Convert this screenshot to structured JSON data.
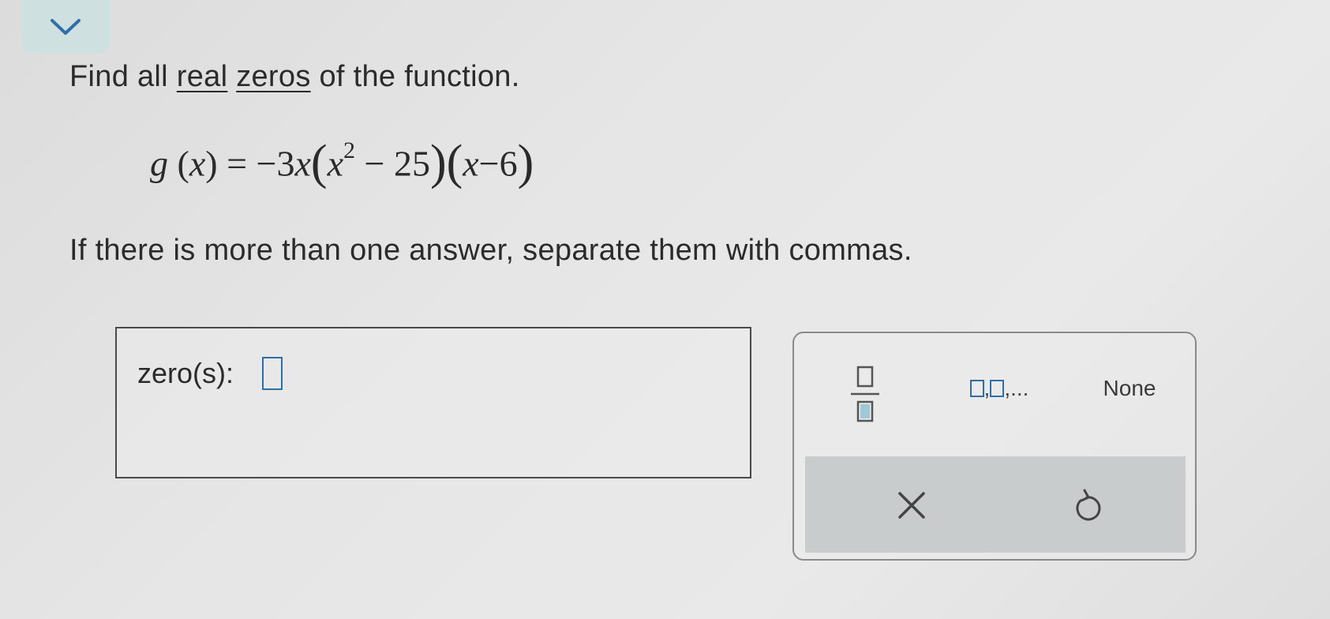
{
  "question": {
    "prefix": "Find all",
    "link_real": "real",
    "link_zeros": "zeros",
    "suffix": "of the function."
  },
  "equation": {
    "func": "g",
    "var": "x",
    "equals": "=",
    "coefficient": "−3",
    "term1_minus": "−",
    "exponent": "2",
    "const1": "25",
    "term2_minus": "−",
    "const2": "6"
  },
  "instruction": "If there is more than one answer, separate them with commas.",
  "answer": {
    "label": "zero(s):",
    "value": ""
  },
  "keypad": {
    "fraction_label": "fraction",
    "list_separator": ",",
    "list_ellipsis": "...",
    "none_label": "None"
  },
  "colors": {
    "accent": "#2f6fa8",
    "collapse_bg": "#cfe0e1",
    "action_bar_bg": "#c9cccc"
  },
  "icons": [
    "chevron-down-icon",
    "fraction-icon",
    "clear-icon",
    "undo-icon"
  ]
}
